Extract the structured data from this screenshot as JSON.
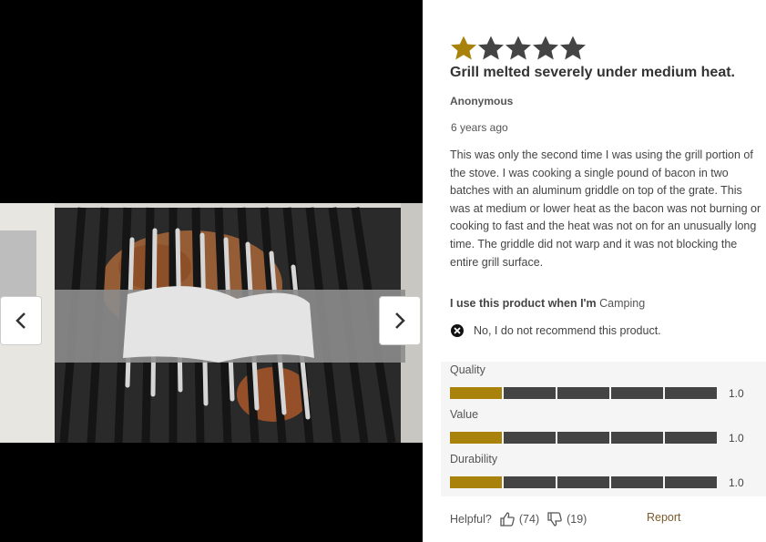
{
  "gallery": {
    "prev_icon": "chevron-left-icon",
    "next_icon": "chevron-right-icon"
  },
  "review": {
    "rating": 1,
    "max_rating": 5,
    "star_filled_color": "#a8820a",
    "star_empty_color": "#444444",
    "title": "Grill melted severely under medium heat.",
    "author": "Anonymous",
    "date": "6 years ago",
    "body": "This was only the second time I was using the grill portion of the stove. I was cooking a single pound of bacon in two batches with an aluminum griddle on top of the grate. This was at medium or lower heat as the bacon was not burning or cooking to fast and the heat was not on for an unusually long time. The griddle did not warp and it was not blocking the entire grill surface.",
    "use_label": "I use this product when I'm",
    "use_value": "Camping",
    "recommend_icon": "x-circle-icon",
    "recommend_text": "No, I do not recommend this product."
  },
  "ratings": [
    {
      "label": "Quality",
      "value": "1.0",
      "level": 1,
      "max": 5
    },
    {
      "label": "Value",
      "value": "1.0",
      "level": 1,
      "max": 5
    },
    {
      "label": "Durability",
      "value": "1.0",
      "level": 1,
      "max": 5
    }
  ],
  "footer": {
    "helpful_label": "Helpful?",
    "upvote_icon": "thumbs-up-icon",
    "upvotes": "(74)",
    "downvote_icon": "thumbs-down-icon",
    "downvotes": "(19)",
    "report_label": "Report"
  }
}
